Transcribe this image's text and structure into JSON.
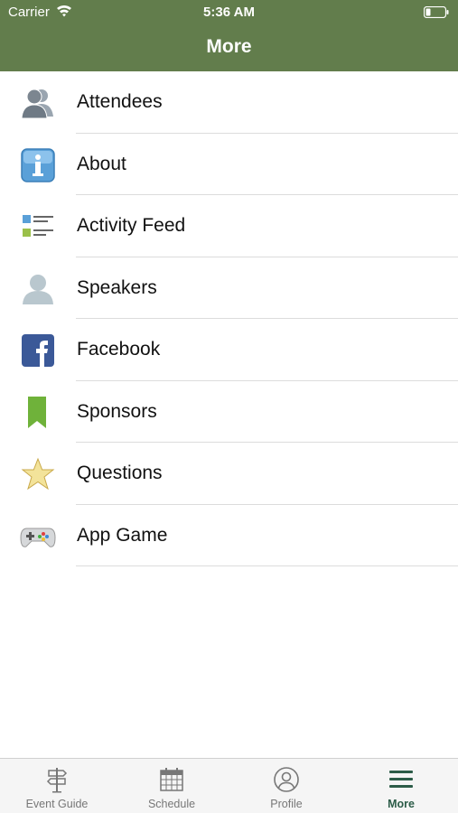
{
  "status": {
    "carrier": "Carrier",
    "time": "5:36 AM"
  },
  "nav": {
    "title": "More"
  },
  "menu": [
    {
      "label": "Attendees",
      "icon": "attendees-icon"
    },
    {
      "label": "About",
      "icon": "info-icon"
    },
    {
      "label": "Activity Feed",
      "icon": "activity-feed-icon"
    },
    {
      "label": "Speakers",
      "icon": "speaker-icon"
    },
    {
      "label": "Facebook",
      "icon": "facebook-icon"
    },
    {
      "label": "Sponsors",
      "icon": "bookmark-icon"
    },
    {
      "label": "Questions",
      "icon": "star-icon"
    },
    {
      "label": "App Game",
      "icon": "gamepad-icon"
    }
  ],
  "tabs": [
    {
      "label": "Event Guide",
      "icon": "signpost-icon"
    },
    {
      "label": "Schedule",
      "icon": "calendar-icon"
    },
    {
      "label": "Profile",
      "icon": "profile-icon"
    },
    {
      "label": "More",
      "icon": "menu-icon",
      "active": true
    }
  ],
  "colors": {
    "header": "#627d4c",
    "active_tab": "#2c5c48"
  }
}
